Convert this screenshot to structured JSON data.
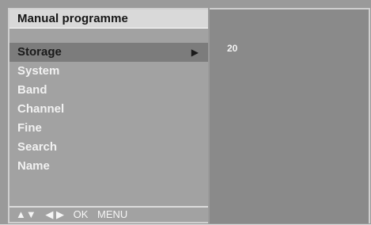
{
  "menu": {
    "title": "Manual programme",
    "items": [
      {
        "label": "Storage",
        "selected": true,
        "icon": "arrow-right-icon"
      },
      {
        "label": "System",
        "selected": false
      },
      {
        "label": "Band",
        "selected": false
      },
      {
        "label": "Channel",
        "selected": false
      },
      {
        "label": "Fine",
        "selected": false
      },
      {
        "label": "Search",
        "selected": false
      },
      {
        "label": "Name",
        "selected": false
      }
    ],
    "footer": {
      "nav_updown": "▲▼",
      "nav_leftright": "◀ ▶",
      "ok": "OK",
      "menu": "MENU"
    }
  },
  "detail": {
    "value": "20"
  },
  "colors": {
    "panel_bg": "#a2a2a2",
    "right_bg": "#8a8a8a",
    "header_bg": "#d9d9d9",
    "selected_bg": "#7c7c7c",
    "text_light": "#f1f1f1",
    "text_dark": "#1a1a1a"
  }
}
